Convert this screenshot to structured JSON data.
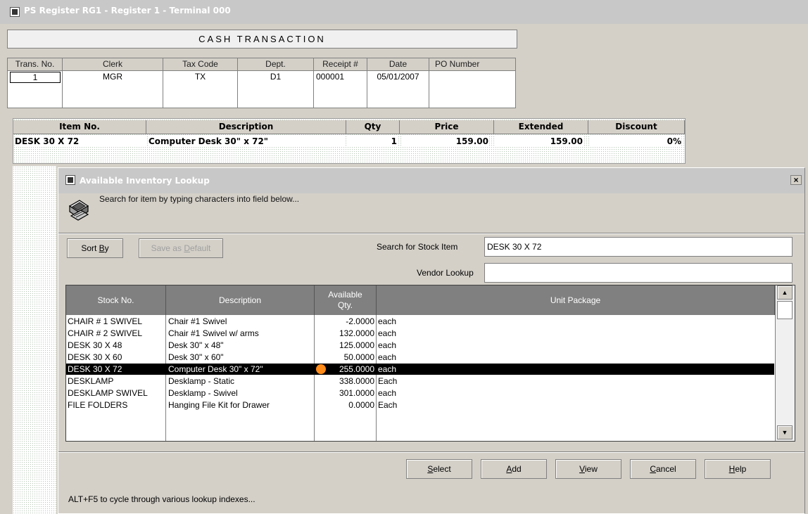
{
  "window": {
    "title": "PS Register RG1 - Register 1 - Terminal 000"
  },
  "mode_label": "CASH TRANSACTION",
  "header": {
    "columns": [
      {
        "label": "Trans. No.",
        "value": "1"
      },
      {
        "label": "Clerk",
        "value": "MGR"
      },
      {
        "label": "Tax Code",
        "value": "TX"
      },
      {
        "label": "Dept.",
        "value": "D1"
      },
      {
        "label": "Receipt #",
        "value": "000001"
      },
      {
        "label": "Date",
        "value": "05/01/2007"
      },
      {
        "label": "PO Number",
        "value": ""
      }
    ]
  },
  "lines": {
    "columns": [
      "Item No.",
      "Description",
      "Qty",
      "Price",
      "Extended",
      "Discount"
    ],
    "rows": [
      {
        "item_no": "DESK 30 X 72",
        "description": "Computer Desk 30\" x 72\"",
        "qty": "1",
        "price": "159.00",
        "extended": "159.00",
        "discount": "0%"
      }
    ]
  },
  "dialog": {
    "title": "Available Inventory Lookup",
    "close_glyph": "×",
    "hint": "Search for item by typing characters into field below...",
    "sort_by": {
      "pre": "Sort ",
      "ul": "B",
      "post": "y"
    },
    "save_default": {
      "pre": "Save as ",
      "ul": "D",
      "post": "efault"
    },
    "search_label": "Search for Stock Item",
    "search_value": "DESK 30 X 72",
    "vendor_label": "Vendor Lookup",
    "vendor_value": "",
    "grid": {
      "columns": [
        "Stock No.",
        "Description",
        "Available Qty.",
        "Unit Package"
      ],
      "rows": [
        {
          "stock_no": "CHAIR # 1 SWIVEL",
          "description": "Chair #1 Swivel",
          "qty": "-2.0000",
          "unit": "each"
        },
        {
          "stock_no": "CHAIR # 2 SWIVEL",
          "description": "Chair #1 Swivel w/ arms",
          "qty": "132.0000",
          "unit": "each"
        },
        {
          "stock_no": "DESK 30 X 48",
          "description": "Desk 30\" x 48\"",
          "qty": "125.0000",
          "unit": "each"
        },
        {
          "stock_no": "DESK 30 X 60",
          "description": "Desk 30\" x 60\"",
          "qty": "50.0000",
          "unit": "each"
        },
        {
          "stock_no": "DESK 30 X 72",
          "description": "Computer Desk 30\" x 72\"",
          "qty": "255.0000",
          "unit": "each",
          "selected": true
        },
        {
          "stock_no": "DESKLAMP",
          "description": "Desklamp - Static",
          "qty": "338.0000",
          "unit": "Each"
        },
        {
          "stock_no": "DESKLAMP SWIVEL",
          "description": "Desklamp - Swivel",
          "qty": "301.0000",
          "unit": "each"
        },
        {
          "stock_no": "FILE FOLDERS",
          "description": "Hanging File Kit for Drawer",
          "qty": "0.0000",
          "unit": "Each"
        }
      ]
    },
    "buttons": {
      "select": {
        "ul": "S",
        "post": "elect"
      },
      "add": {
        "ul": "A",
        "post": "dd"
      },
      "view": {
        "ul": "V",
        "post": "iew"
      },
      "cancel": {
        "ul": "C",
        "post": "ancel"
      },
      "help": {
        "ul": "H",
        "post": "elp"
      }
    },
    "footer": "ALT+F5 to cycle through various lookup indexes..."
  },
  "colors": {
    "selected_row_bg": "#000000",
    "indicator": "#ff8c1a",
    "grid_header_bg": "#808080"
  }
}
